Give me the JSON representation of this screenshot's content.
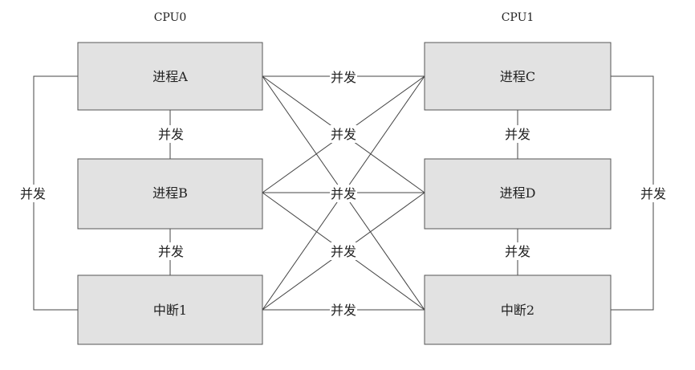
{
  "headers": {
    "cpu0": "CPU0",
    "cpu1": "CPU1"
  },
  "nodes": {
    "procA": "进程A",
    "procB": "进程B",
    "irq1": "中断1",
    "procC": "进程C",
    "procD": "进程D",
    "irq2": "中断2"
  },
  "edge_label": "并发"
}
